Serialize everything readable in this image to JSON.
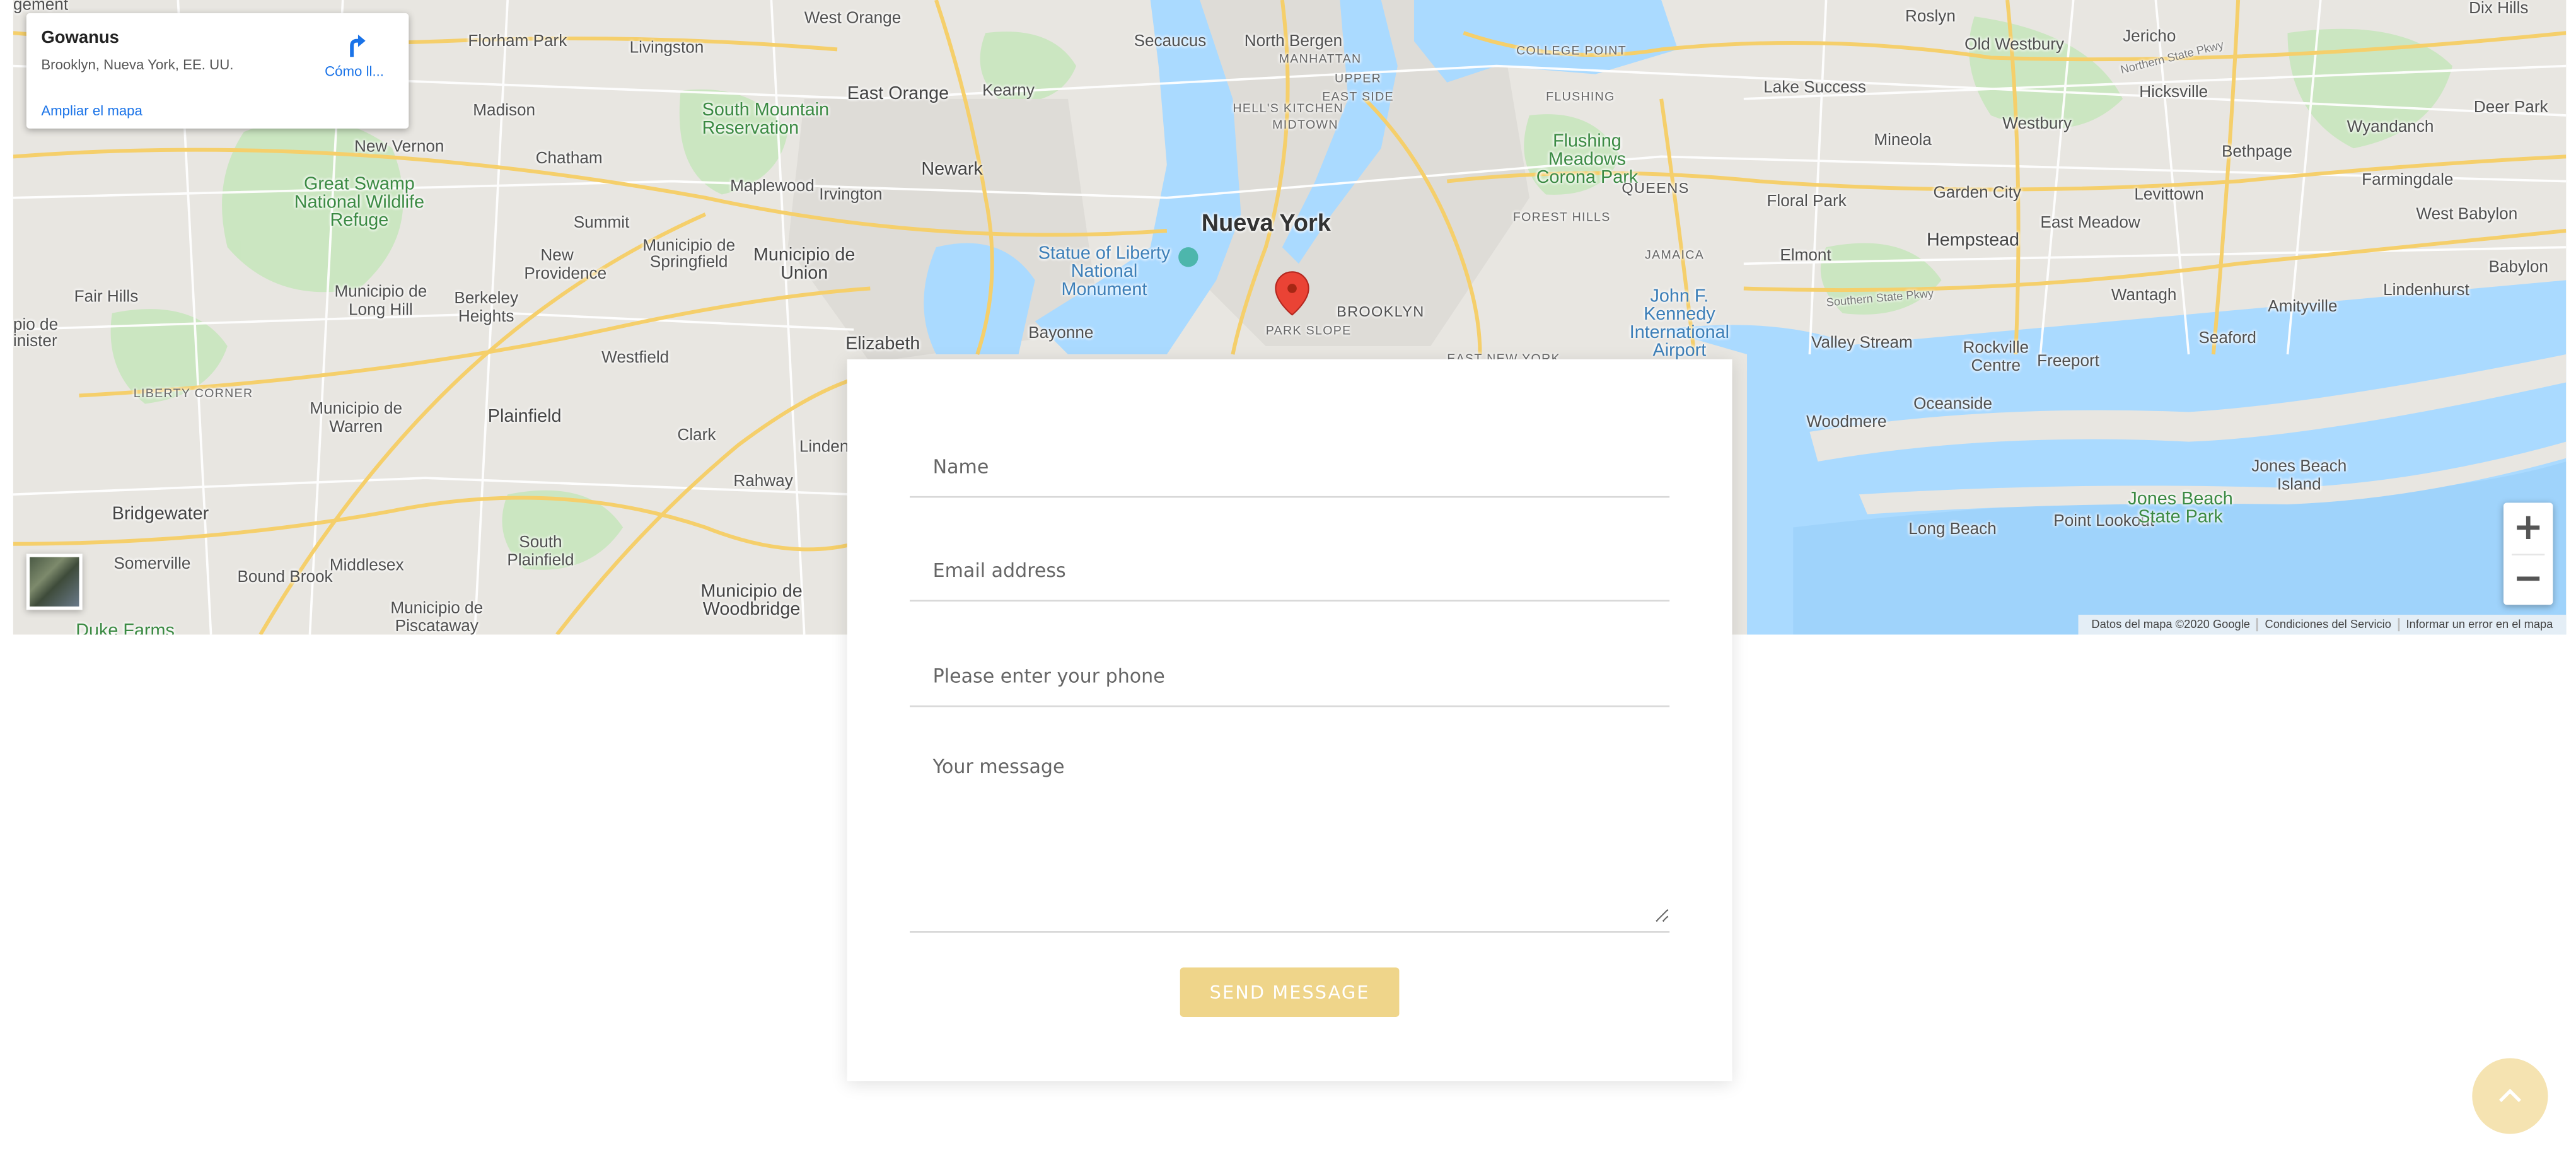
{
  "map": {
    "info_card": {
      "title": "Gowanus",
      "address": "Brooklyn, Nueva York, EE. UU.",
      "directions_label": "Cómo ll...",
      "enlarge_label": "Ampliar el mapa"
    },
    "labels": {
      "nueva_york": "Nueva York",
      "newark": "Newark",
      "brooklyn": "BROOKLYN",
      "park_slope": "PARK SLOPE",
      "manhattan": "MANHATTAN",
      "upper_east_side": "UPPER EAST SIDE",
      "hells_kitchen": "HELL'S KITCHEN",
      "midtown": "MIDTOWN",
      "flushing": "FLUSHING",
      "queens": "QUEENS",
      "jamaica": "JAMAICA",
      "forest_hills": "FOREST HILLS",
      "college_point": "COLLEGE POINT",
      "east_new_york": "EAST NEW YORK",
      "flushing_meadows": "Flushing Meadows Corona Park",
      "jfk": "John F. Kennedy International Airport",
      "statue_of_liberty": "Statue of Liberty National Monument",
      "west_orange": "West Orange",
      "east_orange": "East Orange",
      "secaucus": "Secaucus",
      "north_bergen": "North Bergen",
      "livingston": "Livingston",
      "florham_park": "Florham Park",
      "madison": "Madison",
      "new_vernon": "New Vernon",
      "chatham": "Chatham",
      "south_mountain": "South Mountain Reservation",
      "maplewood": "Maplewood",
      "irvington": "Irvington",
      "kearny": "Kearny",
      "great_swamp": "Great Swamp National Wildlife Refuge",
      "summit": "Summit",
      "municipio_springfield": "Municipio de Springfield",
      "municipio_union": "Municipio de Union",
      "new_providence": "New Providence",
      "fair_hills": "Fair Hills",
      "municipio_long_hill": "Municipio de Long Hill",
      "berkeley_heights": "Berkeley Heights",
      "westfield": "Westfield",
      "elizabeth": "Elizabeth",
      "bayonne": "Bayonne",
      "liberty_corner": "LIBERTY CORNER",
      "municipio_warren": "Municipio de Warren",
      "plainfield": "Plainfield",
      "clark": "Clark",
      "linden": "Linden",
      "rahway": "Rahway",
      "bridgewater": "Bridgewater",
      "somerville": "Somerville",
      "bound_brook": "Bound Brook",
      "middlesex": "Middlesex",
      "south_plainfield": "South Plainfield",
      "municipio_woodbridge": "Municipio de Woodbridge",
      "municipio_piscataway": "Municipio de Piscataway",
      "duke_farms": "Duke Farms",
      "roslyn": "Roslyn",
      "old_westbury": "Old Westbury",
      "jericho": "Jericho",
      "dix_hills": "Dix Hills",
      "lake_success": "Lake Success",
      "hicksville": "Hicksville",
      "deer_park": "Deer Park",
      "wyandanch": "Wyandanch",
      "westbury": "Westbury",
      "bethpage": "Bethpage",
      "mineola": "Mineola",
      "farmingdale": "Farmingdale",
      "garden_city": "Garden City",
      "levittown": "Levittown",
      "west_babylon": "West Babylon",
      "babylon": "Babylon",
      "east_meadow": "East Meadow",
      "floral_park": "Floral Park",
      "hempstead": "Hempstead",
      "elmont": "Elmont",
      "wantagh": "Wantagh",
      "amityville": "Amityville",
      "lindenhurst": "Lindenhurst",
      "valley_stream": "Valley Stream",
      "rockville_centre": "Rockville Centre",
      "freeport": "Freeport",
      "seaford": "Seaford",
      "oceanside": "Oceanside",
      "woodmere": "Woodmere",
      "long_beach": "Long Beach",
      "point_lookout": "Point Lookout",
      "jones_beach_state_park": "Jones Beach State Park",
      "jones_beach_island": "Jones Beach Island",
      "southern_state_pkwy": "Southern State Pkwy",
      "northern_state_pkwy": "Northern State Pkwy",
      "gement": "gement",
      "inister": "inister",
      "pio_de": "pio de"
    },
    "zoom_in_label": "+",
    "zoom_out_label": "−",
    "footer": {
      "data_credit": "Datos del mapa ©2020 Google",
      "terms": "Condiciones del Servicio",
      "report": "Informar un error en el mapa"
    },
    "colors": {
      "water": "#aadaff",
      "land": "#e8e6e1",
      "park": "#c7e5bd",
      "highway": "#f8d57e",
      "pin": "#ea4335"
    }
  },
  "form": {
    "name_placeholder": "Name",
    "email_placeholder": "Email address",
    "phone_placeholder": "Please enter your phone",
    "message_placeholder": "Your message",
    "send_label": "SEND MESSAGE",
    "accent_color": "#efd58a"
  },
  "scroll_top": {
    "icon": "chevron-up-icon"
  }
}
